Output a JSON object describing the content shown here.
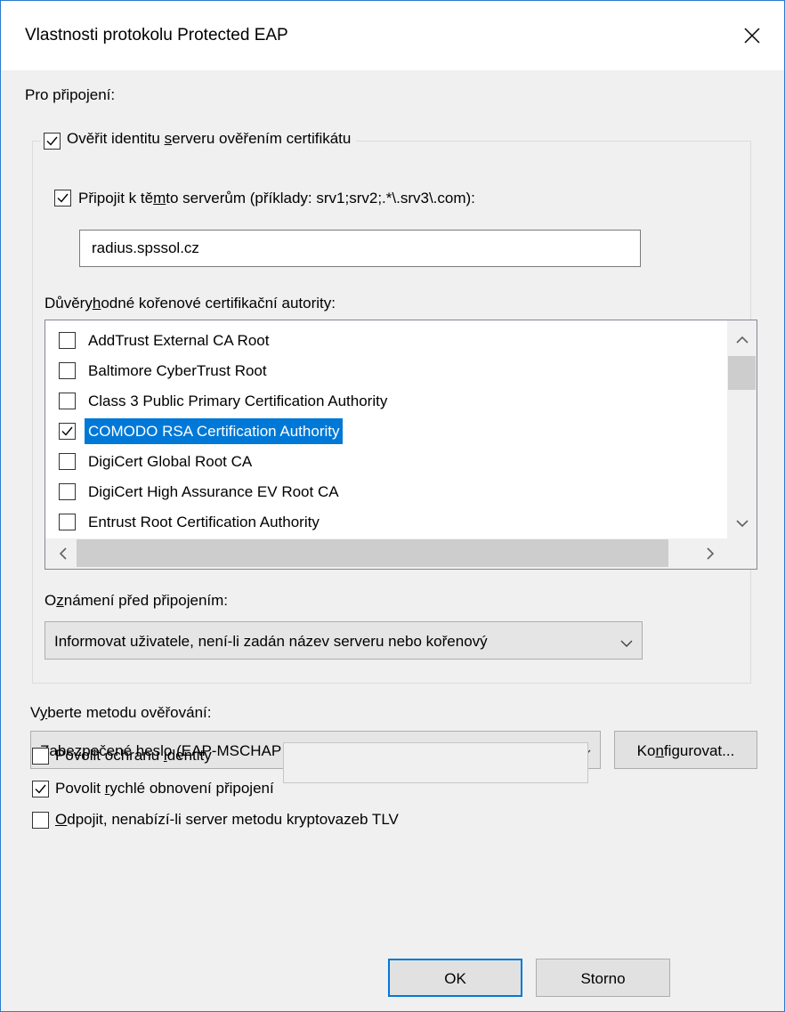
{
  "window": {
    "title": "Vlastnosti protokolu Protected EAP",
    "close_symbol": "✕"
  },
  "connection": {
    "label": "Pro připojení:",
    "verify_server": {
      "label_before": "Ověřit identitu ",
      "label_accel": "s",
      "label_after": "erveru ověřením certifikátu",
      "checked": true
    },
    "connect_servers": {
      "label_before": "Připojit k tě",
      "label_accel": "m",
      "label_after": "to serverům (příklady: srv1;srv2;.*\\.srv3\\.com):",
      "checked": true,
      "value": "radius.spssol.cz"
    },
    "trusted_ca": {
      "label_before": "Důvěry",
      "label_accel": "h",
      "label_after": "odné kořenové certifikační autority:",
      "items": [
        {
          "label": "AddTrust External CA Root",
          "checked": false,
          "selected": false
        },
        {
          "label": "Baltimore CyberTrust Root",
          "checked": false,
          "selected": false
        },
        {
          "label": "Class 3 Public Primary Certification Authority",
          "checked": false,
          "selected": false
        },
        {
          "label": "COMODO RSA Certification Authority",
          "checked": true,
          "selected": true
        },
        {
          "label": "DigiCert Global Root CA",
          "checked": false,
          "selected": false
        },
        {
          "label": "DigiCert High Assurance EV Root CA",
          "checked": false,
          "selected": false
        },
        {
          "label": "Entrust Root Certification Authority",
          "checked": false,
          "selected": false
        }
      ]
    },
    "notification": {
      "label_before": "O",
      "label_accel": "z",
      "label_after": "námení před připojením:",
      "value": "Informovat uživatele, není-li zadán název serveru nebo kořenový"
    }
  },
  "method": {
    "label_before": "V",
    "label_accel": "y",
    "label_after": "berte metodu ověřování:",
    "value": "Zabezpečené heslo (EAP-MSCHAP v2)",
    "configure_before": "Ko",
    "configure_accel": "n",
    "configure_after": "figurovat..."
  },
  "options": {
    "fast_reconnect": {
      "before": "Povolit ",
      "accel": "r",
      "after": "ychlé obnovení připojení",
      "checked": true
    },
    "disconnect_tlv": {
      "before": "",
      "accel": "O",
      "after": "dpojit, nenabízí-li server metodu kryptovazeb TLV",
      "checked": false
    },
    "identity_privacy": {
      "before": "Povolit ochranu ",
      "accel": "i",
      "after": "dentity",
      "checked": false
    }
  },
  "buttons": {
    "ok": "OK",
    "cancel": "Storno"
  }
}
